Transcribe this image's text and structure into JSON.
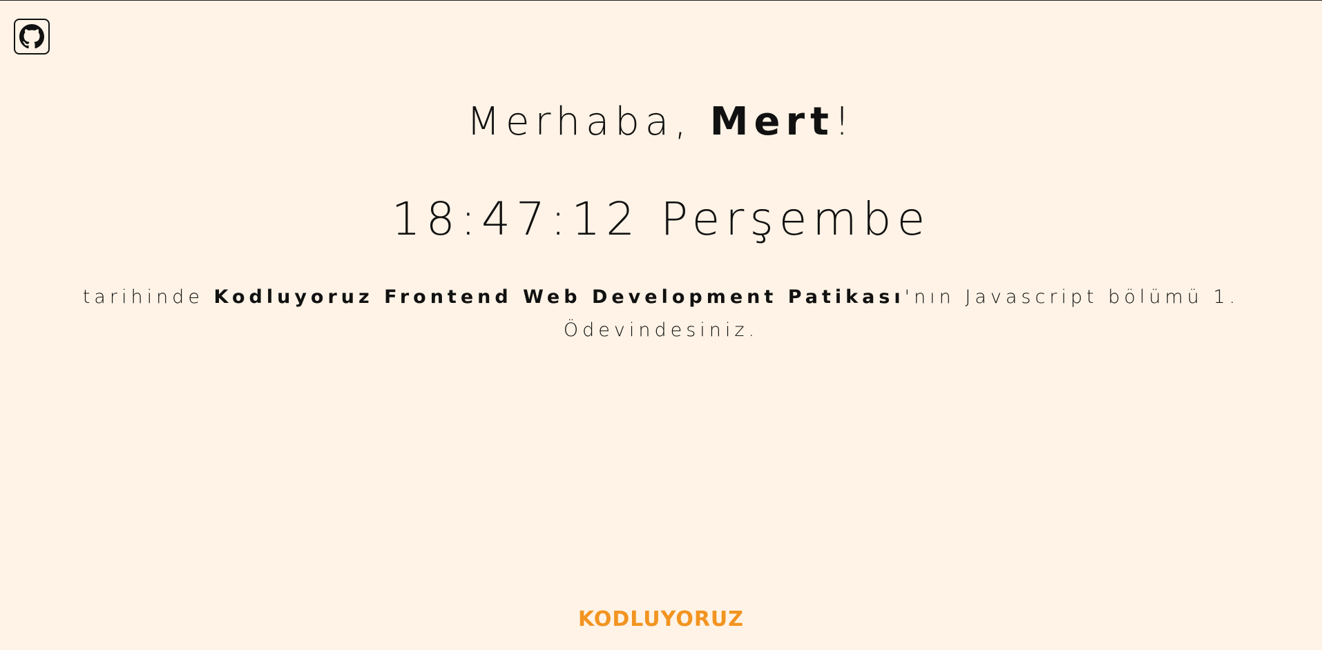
{
  "github": {
    "icon": "github-icon"
  },
  "greeting": {
    "prefix": "Merhaba, ",
    "name": "Mert",
    "suffix": "!"
  },
  "clock": {
    "time": "18:47:12",
    "day": "Perşembe"
  },
  "info": {
    "prefix": "tarihinde ",
    "course": "Kodluyoruz Frontend Web Development Patikası",
    "suffix": "'nın Javascript bölümü 1. Ödevindesiniz."
  },
  "footer": {
    "logo_text": "KODLUYORUZ",
    "logo_color": "#f29420"
  },
  "colors": {
    "background": "#fef3e6",
    "text": "#111111"
  }
}
